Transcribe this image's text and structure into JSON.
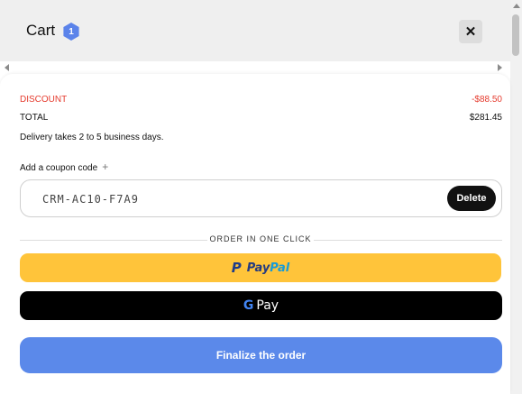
{
  "header": {
    "title": "Cart",
    "badge_count": "1",
    "close_label": "✕"
  },
  "summary": {
    "discount_label": "DISCOUNT",
    "discount_value": "-$88.50",
    "total_label": "TOTAL",
    "total_value": "$281.45",
    "delivery_note": "Delivery takes 2 to 5 business days."
  },
  "coupon": {
    "toggle_label": "Add a coupon code",
    "toggle_icon": "plus-icon",
    "code_value": "CRM-AC10-F7A9",
    "delete_label": "Delete"
  },
  "one_click": {
    "divider_label": "ORDER IN ONE CLICK",
    "paypal_pay": "Pay",
    "paypal_pal": "Pal",
    "gpay_g": "G",
    "gpay_label": "Pay"
  },
  "checkout": {
    "finalize_label": "Finalize the order"
  },
  "colors": {
    "accent": "#5b89ea",
    "discount": "#e53b2e",
    "paypal_bg": "#ffc43a",
    "gpay_bg": "#000000"
  }
}
